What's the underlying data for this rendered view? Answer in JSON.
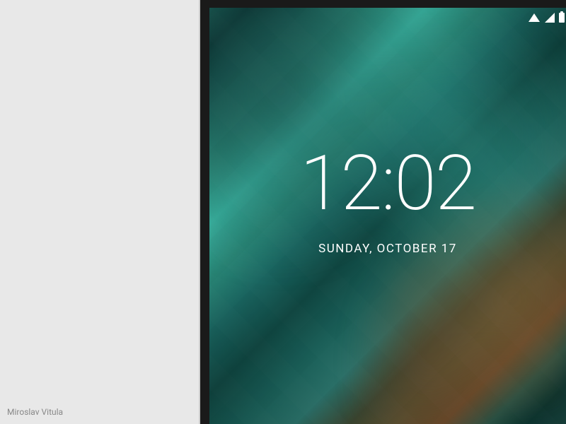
{
  "author": "Miroslav Vitula",
  "lockscreen": {
    "time": "12:02",
    "date": "SUNDAY, OCTOBER 17"
  },
  "status_bar": {
    "wifi": "wifi-icon",
    "cellular": "cellular-icon",
    "battery": "battery-icon"
  }
}
